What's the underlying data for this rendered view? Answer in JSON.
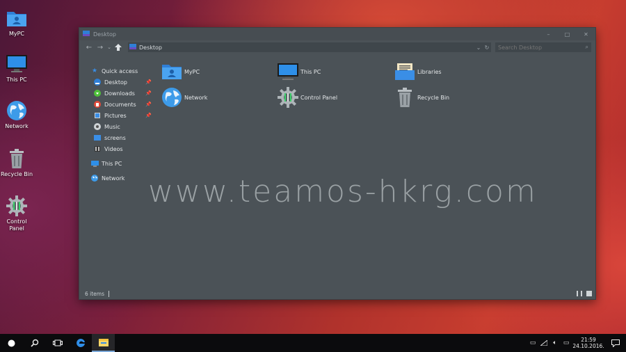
{
  "desktop": {
    "icons": [
      {
        "label": "MyPC",
        "icon": "blue-user-folder-icon"
      },
      {
        "label": "This PC",
        "icon": "monitor-icon"
      },
      {
        "label": "Network",
        "icon": "globe-icon"
      },
      {
        "label": "Recycle Bin",
        "icon": "trash-icon"
      },
      {
        "label": "Control Panel",
        "icon": "gear-panel-icon"
      }
    ]
  },
  "window": {
    "title": "Desktop",
    "controls": {
      "minimize": "–",
      "maximize": "□",
      "close": "✕"
    },
    "address": {
      "path": "Desktop"
    },
    "search": {
      "placeholder": "Search Desktop"
    },
    "nav": {
      "quick_access": "Quick access",
      "quick_items": [
        "Desktop",
        "Downloads",
        "Documents",
        "Pictures",
        "Music",
        "screens",
        "Videos"
      ],
      "this_pc": "This PC",
      "network": "Network"
    },
    "items": [
      "MyPC",
      "This PC",
      "Libraries",
      "Network",
      "Control Panel",
      "Recycle Bin"
    ],
    "status": "6 items"
  },
  "watermark": "www.teamos-hkrg.com",
  "taskbar": {
    "clock_time": "21:59",
    "clock_date": "24.10.2016."
  },
  "colors": {
    "accent": "#3a8ee6",
    "window_bg": "#4b5257",
    "taskbar_bg": "#0b0b0d"
  }
}
